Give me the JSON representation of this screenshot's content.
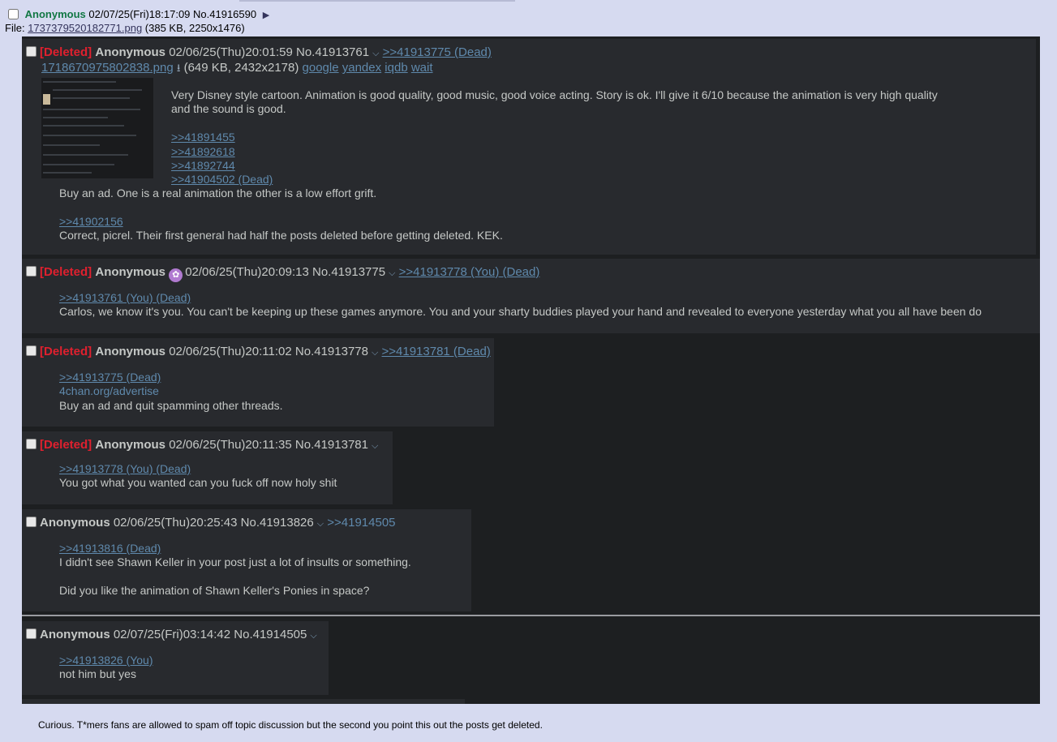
{
  "op": {
    "name": "Anonymous",
    "datetime": "02/07/25(Fri)18:17:09",
    "number": "No.41916590",
    "file_label": "File:",
    "file_name": "1737379520182771.png",
    "file_info": "(385 KB, 2250x1476)"
  },
  "posts": [
    {
      "deleted": "[Deleted]",
      "name": "Anonymous",
      "datetime": "02/06/25(Thu)20:01:59",
      "number": "No.41913761",
      "replies": ">>41913775 (Dead)",
      "file_name": "1718670975802838.png",
      "file_info": "(649 KB, 2432x2178)",
      "search": [
        "google",
        "yandex",
        "iqdb",
        "wait"
      ],
      "text1": "Very Disney style cartoon. Animation is good quality, good music, good voice acting. Story is ok. I'll give it 6/10 because the animation is very high quality",
      "text2": "and the sound is good.",
      "quotes": [
        ">>41891455",
        ">>41892618",
        ">>41892744",
        ">>41904502 (Dead)"
      ],
      "text3": "Buy an ad. One is a real animation the other is a low effort grift.",
      "quote2": ">>41902156",
      "text4": "Correct, picrel. Their first general had half the posts deleted before getting deleted. KEK."
    },
    {
      "deleted": "[Deleted]",
      "name": "Anonymous",
      "datetime": "02/06/25(Thu)20:09:13",
      "number": "No.41913775",
      "replies": ">>41913778 (You) (Dead)",
      "quote": ">>41913761 (You) (Dead)",
      "text": "Carlos, we know it's you. You can't be keeping up these games anymore. You and your sharty buddies played your hand and revealed to everyone yesterday what you all have been do"
    },
    {
      "deleted": "[Deleted]",
      "name": "Anonymous",
      "datetime": "02/06/25(Thu)20:11:02",
      "number": "No.41913778",
      "replies": ">>41913781 (Dead)",
      "quote": ">>41913775 (Dead)",
      "link": "4chan.org/advertise",
      "text": "Buy an ad and quit spamming other threads."
    },
    {
      "deleted": "[Deleted]",
      "name": "Anonymous",
      "datetime": "02/06/25(Thu)20:11:35",
      "number": "No.41913781",
      "quote": ">>41913778 (You) (Dead)",
      "text": "You got what you wanted can you fuck off now holy shit"
    },
    {
      "name": "Anonymous",
      "datetime": "02/06/25(Thu)20:25:43",
      "number": "No.41913826",
      "replies": ">>41914505",
      "quote": ">>41913816 (Dead)",
      "text1": "I didn't see Shawn Keller in your post just a lot of insults or something.",
      "text2": "Did you like the animation of Shawn Keller's Ponies in space?"
    },
    {
      "name": "Anonymous",
      "datetime": "02/07/25(Fri)03:14:42",
      "number": "No.41914505",
      "quote": ">>41913826 (You)",
      "text": "not him but yes"
    }
  ],
  "footer": "Curious. T*mers fans are allowed to spam off topic discussion but the second you point this out the posts get deleted."
}
